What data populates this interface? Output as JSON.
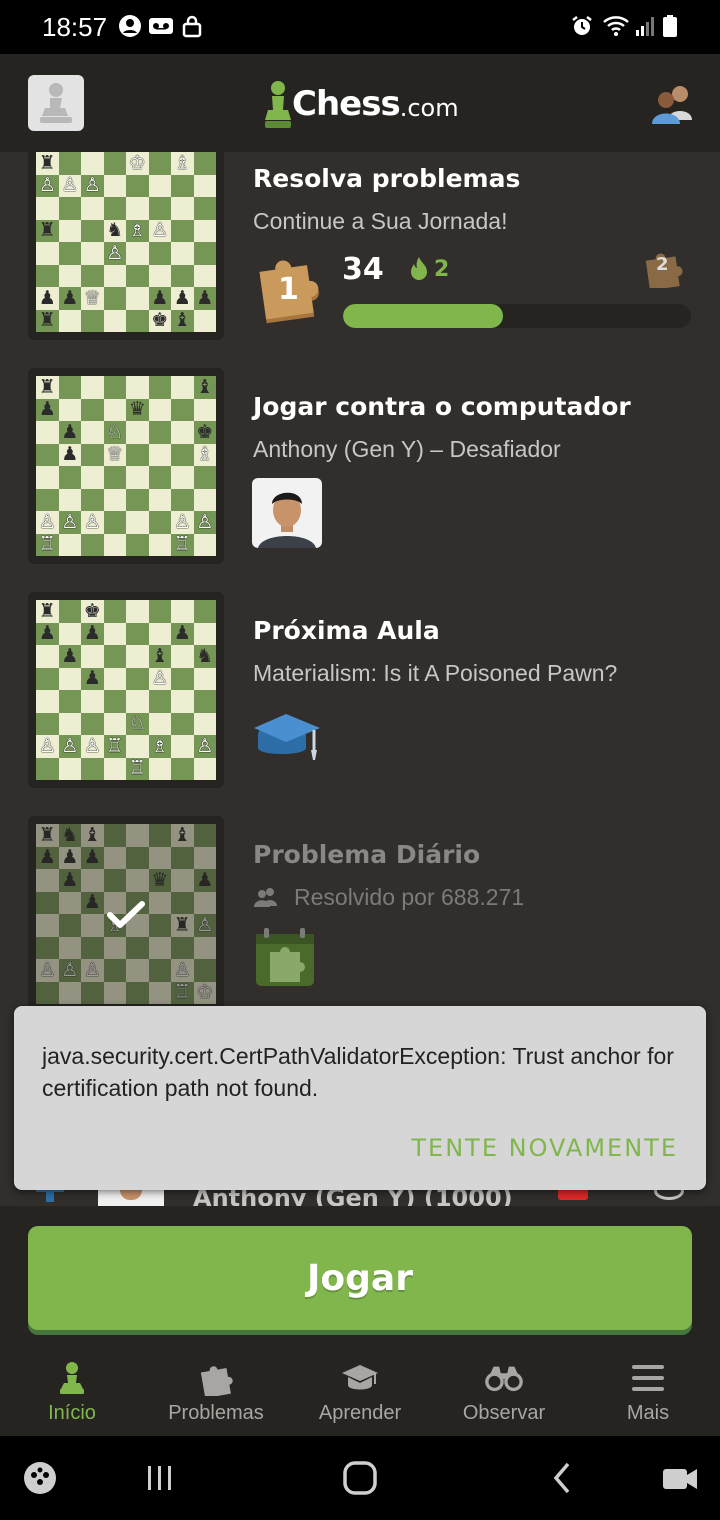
{
  "status_bar": {
    "time": "18:57"
  },
  "header": {
    "logo_text": "Chess",
    "logo_suffix": ".com"
  },
  "cards": {
    "puzzles": {
      "title": "Resolva problemas",
      "subtitle": "Continue a Sua Jornada!",
      "rating": "34",
      "streak": "2",
      "level_current": "1",
      "level_next": "2",
      "progress": 0.46
    },
    "computer": {
      "title": "Jogar contra o computador",
      "subtitle": "Anthony (Gen Y) – Desafiador"
    },
    "lesson": {
      "title": "Próxima Aula",
      "subtitle": "Materialism: Is it A Poisoned Pawn?"
    },
    "daily": {
      "title": "Problema Diário",
      "subtitle": "Resolvido por 688.271"
    }
  },
  "boards": {
    "puzzles": [
      "♜...♔.♗.♜",
      "♙♙♙.....♙",
      "........♙",
      "♜..♞♗♙..",
      "...♙....",
      "........",
      "♟♟♕..♟♟♟",
      "♜....♚♝.♜"
    ],
    "computer": [
      "♜......♝.♜",
      "♟...♛...♟♟",
      ".♟.♘...♚",
      ".♟.♕...♗",
      "........",
      "........",
      "♙♙♙...♙♙♙",
      "♖.....♖.♔"
    ],
    "lesson": [
      "♜.♚......♜",
      "♟.♟...♟.♟",
      ".♟...♝.♞♟",
      "..♟..♙...",
      "........",
      "....♘...♙",
      "♙♙♙♖.♗.♙.",
      "....♖...♔"
    ],
    "daily": [
      "♜♞♝...♝.♜",
      "♟♟♟.......",
      ".♟...♛.♟♙",
      "..♟......",
      "...♗..♜♙.",
      "........",
      "♙♙♙...♙.♙",
      "......♖♔."
    ]
  },
  "toast": {
    "message": "java.security.cert.CertPathValidatorException: Trust anchor for certification path not found.",
    "action": "TENTE NOVAMENTE"
  },
  "peek_row": {
    "name": "Anthony (Gen Y) (1000)"
  },
  "play_button": {
    "label": "Jogar"
  },
  "bottom_nav": {
    "items": [
      {
        "label": "Início",
        "icon": "pawn-icon"
      },
      {
        "label": "Problemas",
        "icon": "puzzle-icon"
      },
      {
        "label": "Aprender",
        "icon": "graduation-cap-icon"
      },
      {
        "label": "Observar",
        "icon": "binoculars-icon"
      },
      {
        "label": "Mais",
        "icon": "menu-icon"
      }
    ]
  },
  "colors": {
    "accent": "#81b64c",
    "background": "#312e2b",
    "header": "#262421",
    "board_light": "#eeeed2",
    "board_dark": "#769656"
  }
}
